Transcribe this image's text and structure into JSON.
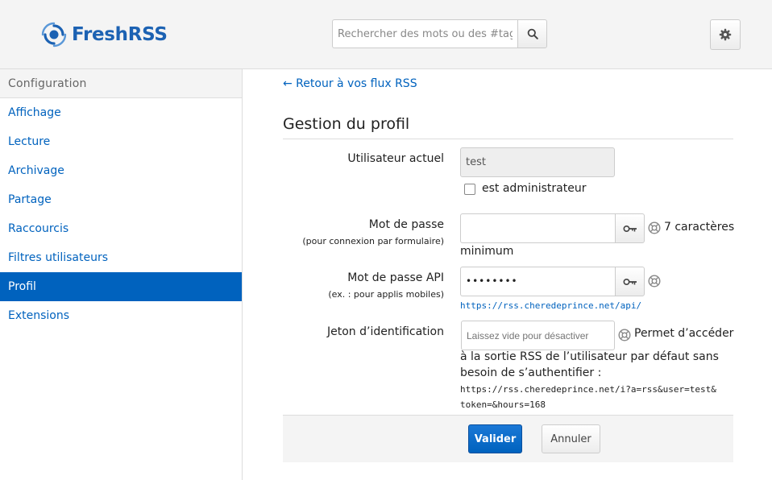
{
  "app": {
    "logo_text": "FreshRSS",
    "brand_color": "#1c62b3",
    "accent_color": "#0062be"
  },
  "header": {
    "search_placeholder": "Rechercher des mots ou des #tags",
    "search_icon": "search-icon",
    "settings_icon": "gear-icon"
  },
  "sidebar": {
    "title": "Configuration",
    "items": [
      {
        "label": "Affichage",
        "active": false
      },
      {
        "label": "Lecture",
        "active": false
      },
      {
        "label": "Archivage",
        "active": false
      },
      {
        "label": "Partage",
        "active": false
      },
      {
        "label": "Raccourcis",
        "active": false
      },
      {
        "label": "Filtres utilisateurs",
        "active": false
      },
      {
        "label": "Profil",
        "active": true
      },
      {
        "label": "Extensions",
        "active": false
      }
    ]
  },
  "main": {
    "back_link": "← Retour à vos flux RSS",
    "title": "Gestion du profil",
    "current_user": {
      "label": "Utilisateur actuel",
      "value": "test",
      "admin_checkbox_label": "est administrateur",
      "admin_checked": false
    },
    "password": {
      "label": "Mot de passe",
      "sublabel": "(pour connexion par formulaire)",
      "value": "",
      "help_line1": "7 caractères",
      "help_line2": "minimum",
      "toggle_icon": "key-icon",
      "help_icon": "help-icon"
    },
    "api_password": {
      "label": "Mot de passe API",
      "sublabel": "(ex. : pour applis mobiles)",
      "value": "••••••••",
      "api_url": "https://rss.cheredeprince.net/api/",
      "toggle_icon": "key-icon",
      "help_icon": "help-icon"
    },
    "token": {
      "label": "Jeton d’identification",
      "placeholder": "Laissez vide pour désactiver",
      "help_line1": "Permet d’accéder",
      "help_line2": "à la sortie RSS de l’utilisateur par défaut sans",
      "help_line3": "besoin de s’authentifier :",
      "url_line1": "https://rss.cheredeprince.net/i?a=rss&user=test&",
      "url_line2": "token=&hours=168"
    },
    "buttons": {
      "submit": "Valider",
      "cancel": "Annuler"
    }
  }
}
